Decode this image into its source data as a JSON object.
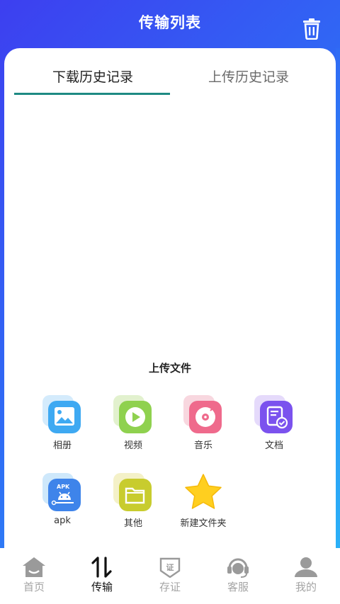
{
  "header": {
    "title": "传输列表",
    "trash_icon": "trash-icon"
  },
  "tabs": [
    {
      "label": "下载历史记录",
      "active": true
    },
    {
      "label": "上传历史记录",
      "active": false
    }
  ],
  "upload": {
    "title": "上传文件",
    "items": [
      {
        "label": "相册",
        "icon": "photo-album-icon"
      },
      {
        "label": "视频",
        "icon": "video-icon"
      },
      {
        "label": "音乐",
        "icon": "music-icon"
      },
      {
        "label": "文档",
        "icon": "document-icon"
      },
      {
        "label": "apk",
        "icon": "apk-icon",
        "badge": "APK"
      },
      {
        "label": "其他",
        "icon": "folder-icon"
      },
      {
        "label": "新建文件夹",
        "icon": "star-icon"
      }
    ]
  },
  "tabbar": [
    {
      "label": "首页",
      "icon": "home-icon",
      "active": false
    },
    {
      "label": "传输",
      "icon": "transfer-icon",
      "active": true
    },
    {
      "label": "存证",
      "icon": "certificate-icon",
      "active": false
    },
    {
      "label": "客服",
      "icon": "customer-service-icon",
      "active": false
    },
    {
      "label": "我的",
      "icon": "user-icon",
      "active": false
    }
  ],
  "colors": {
    "accent": "#1e8a83",
    "header_gradient_start": "#3d3ff0",
    "header_gradient_end": "#2aa6f7"
  }
}
